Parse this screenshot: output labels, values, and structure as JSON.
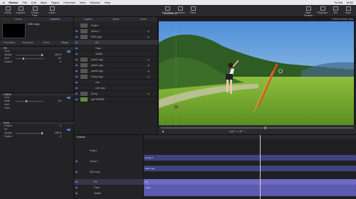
{
  "menubar": {
    "items": [
      "Motion",
      "File",
      "Edit",
      "Mark",
      "Object",
      "Favorites",
      "View",
      "Window",
      "Help"
    ],
    "status": [
      "Fri 8/5",
      "10:52"
    ]
  },
  "toolbar": {
    "doc_title": "shot tracer",
    "left_buttons": [
      "Library",
      "Inspector",
      "Project Pane",
      "Import"
    ],
    "center_buttons": [
      "Add Object",
      "Behaviors",
      "Filters"
    ],
    "right_buttons": [
      "Make Particles",
      "Replicator",
      "Text",
      "Share"
    ],
    "zoom": "Fit 63%",
    "render": "Render",
    "view": "View"
  },
  "left_panel": {
    "tabs": [
      "Library",
      "Inspector"
    ],
    "layer_name": "DDD copy",
    "inspector_tabs": [
      "Properties",
      "Behaviors",
      "Filters",
      "Shape"
    ],
    "sections": [
      {
        "title": "Fill",
        "rows": [
          {
            "label": "Color",
            "value": ""
          },
          {
            "label": "Opacity",
            "value": "100 %"
          },
          {
            "label": "Start",
            "value": "0.0"
          },
          {
            "label": "Feather",
            "value": "0"
          }
        ]
      },
      {
        "title": "Outline",
        "rows": [
          {
            "label": "Color",
            "value": ""
          },
          {
            "label": "Width",
            "value": "4.0"
          },
          {
            "label": "Joint",
            "value": ""
          },
          {
            "label": "Order",
            "value": ""
          }
        ]
      },
      {
        "title": "Point",
        "rows": [
          {
            "label": "Position",
            "value": "0"
          },
          {
            "label": "Fill",
            "value": ""
          },
          {
            "label": "Opacity",
            "value": "100 %"
          },
          {
            "label": "Feather",
            "value": "0"
          }
        ]
      }
    ]
  },
  "layers_panel": {
    "tabs": [
      "Layers",
      "Media",
      "Audio"
    ],
    "rows": [
      "Project",
      "Group 2",
      "DDD copy",
      "Fill",
      "Trace",
      "Outline",
      "pointC copy",
      "pointC copy",
      "pointD copy",
      "Group copy",
      "Line",
      "Line copy",
      "Group",
      "golf 1900359"
    ]
  },
  "timeline": {
    "title": "Timeline",
    "rows": [
      "Project",
      "Group 2",
      "DDD copy",
      "Fill",
      "Trace",
      "Outline"
    ],
    "clips": [
      "Group 2",
      "DDD copy",
      "Fill",
      "Trace"
    ],
    "timecode": "00:00:08;14"
  },
  "colors": {
    "accent": "#5d6fd6",
    "clip": "#4b4f9a",
    "clip_light": "#6e6bc4"
  }
}
